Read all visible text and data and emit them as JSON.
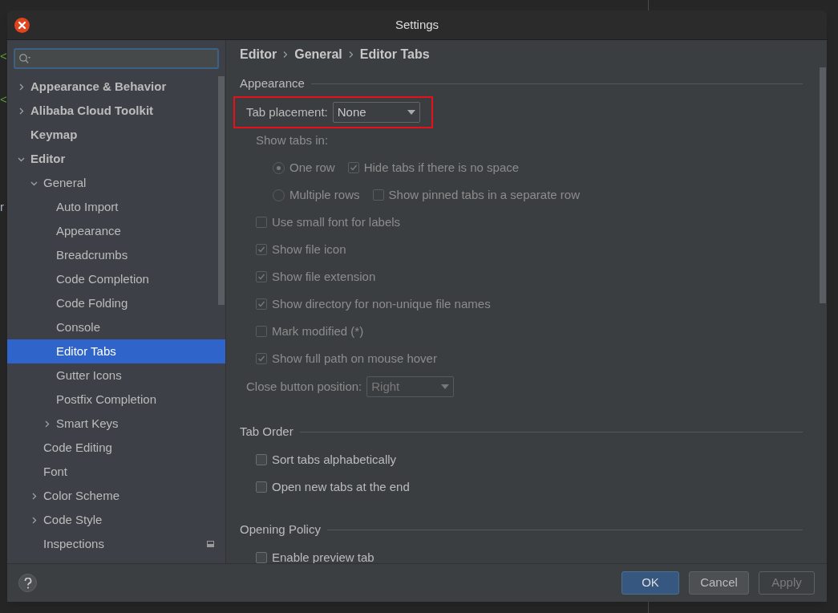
{
  "background_editor": {
    "fragments": [
      {
        "text": "<",
        "kind": "tag"
      },
      {
        "text": "<",
        "kind": "tag"
      },
      {
        "text": "r",
        "kind": "plain"
      }
    ]
  },
  "window": {
    "title": "Settings"
  },
  "sidebar": {
    "items": [
      {
        "label": "Appearance & Behavior",
        "bold": true,
        "expanded": false,
        "selected": false
      },
      {
        "label": "Alibaba Cloud Toolkit",
        "bold": true,
        "expanded": false,
        "selected": false
      },
      {
        "label": "Keymap",
        "bold": true,
        "selected": false
      },
      {
        "label": "Editor",
        "bold": true,
        "expanded": true,
        "selected": false,
        "children": [
          {
            "label": "General",
            "bold": false,
            "expanded": true,
            "selected": false,
            "children": [
              {
                "label": "Auto Import",
                "bold": false,
                "selected": false
              },
              {
                "label": "Appearance",
                "bold": false,
                "selected": false
              },
              {
                "label": "Breadcrumbs",
                "bold": false,
                "selected": false
              },
              {
                "label": "Code Completion",
                "bold": false,
                "selected": false
              },
              {
                "label": "Code Folding",
                "bold": false,
                "selected": false
              },
              {
                "label": "Console",
                "bold": false,
                "selected": false
              },
              {
                "label": "Editor Tabs",
                "bold": false,
                "selected": true
              },
              {
                "label": "Gutter Icons",
                "bold": false,
                "selected": false
              },
              {
                "label": "Postfix Completion",
                "bold": false,
                "selected": false
              },
              {
                "label": "Smart Keys",
                "bold": false,
                "expanded": false,
                "selected": false
              }
            ]
          },
          {
            "label": "Code Editing",
            "bold": false,
            "selected": false
          },
          {
            "label": "Font",
            "bold": false,
            "selected": false
          },
          {
            "label": "Color Scheme",
            "bold": false,
            "expanded": false,
            "selected": false
          },
          {
            "label": "Code Style",
            "bold": false,
            "expanded": false,
            "selected": false
          },
          {
            "label": "Inspections",
            "bold": false,
            "selected": false,
            "project_level": true
          }
        ]
      }
    ]
  },
  "breadcrumbs": [
    "Editor",
    "General",
    "Editor Tabs"
  ],
  "sections": [
    {
      "title": "Appearance",
      "options": [
        {
          "kind": "dropdown",
          "label": "Tab placement:",
          "value": "None",
          "disabled": false,
          "highlighted": true
        },
        {
          "kind": "label",
          "label": "Show tabs in:",
          "disabled": true
        },
        {
          "kind": "row",
          "items": [
            {
              "kind": "radio",
              "label": "One row",
              "selected": true,
              "disabled": true
            },
            {
              "kind": "checkbox",
              "label": "Hide tabs if there is no space",
              "checked": true,
              "disabled": true
            }
          ]
        },
        {
          "kind": "row",
          "items": [
            {
              "kind": "radio",
              "label": "Multiple rows",
              "selected": false,
              "disabled": true
            },
            {
              "kind": "checkbox",
              "label": "Show pinned tabs in a separate row",
              "checked": false,
              "disabled": true
            }
          ]
        },
        {
          "kind": "checkbox",
          "label": "Use small font for labels",
          "checked": false,
          "disabled": true
        },
        {
          "kind": "checkbox",
          "label": "Show file icon",
          "checked": true,
          "disabled": true
        },
        {
          "kind": "checkbox",
          "label": "Show file extension",
          "checked": true,
          "disabled": true
        },
        {
          "kind": "checkbox",
          "label": "Show directory for non-unique file names",
          "checked": true,
          "disabled": true
        },
        {
          "kind": "checkbox",
          "label": "Mark modified (*)",
          "checked": false,
          "disabled": true
        },
        {
          "kind": "checkbox",
          "label": "Show full path on mouse hover",
          "checked": true,
          "disabled": true
        },
        {
          "kind": "dropdown",
          "label": "Close button position:",
          "value": "Right",
          "disabled": true,
          "highlighted": false
        }
      ]
    },
    {
      "title": "Tab Order",
      "options": [
        {
          "kind": "checkbox",
          "label": "Sort tabs alphabetically",
          "checked": false,
          "disabled": false
        },
        {
          "kind": "checkbox",
          "label": "Open new tabs at the end",
          "checked": false,
          "disabled": false
        }
      ]
    },
    {
      "title": "Opening Policy",
      "options": [
        {
          "kind": "checkbox",
          "label": "Enable preview tab",
          "checked": false,
          "disabled": false
        }
      ]
    }
  ],
  "footer": {
    "buttons": [
      {
        "label": "OK",
        "kind": "default",
        "disabled": false
      },
      {
        "label": "Cancel",
        "kind": "normal",
        "disabled": false
      },
      {
        "label": "Apply",
        "kind": "normal",
        "disabled": true
      }
    ]
  }
}
